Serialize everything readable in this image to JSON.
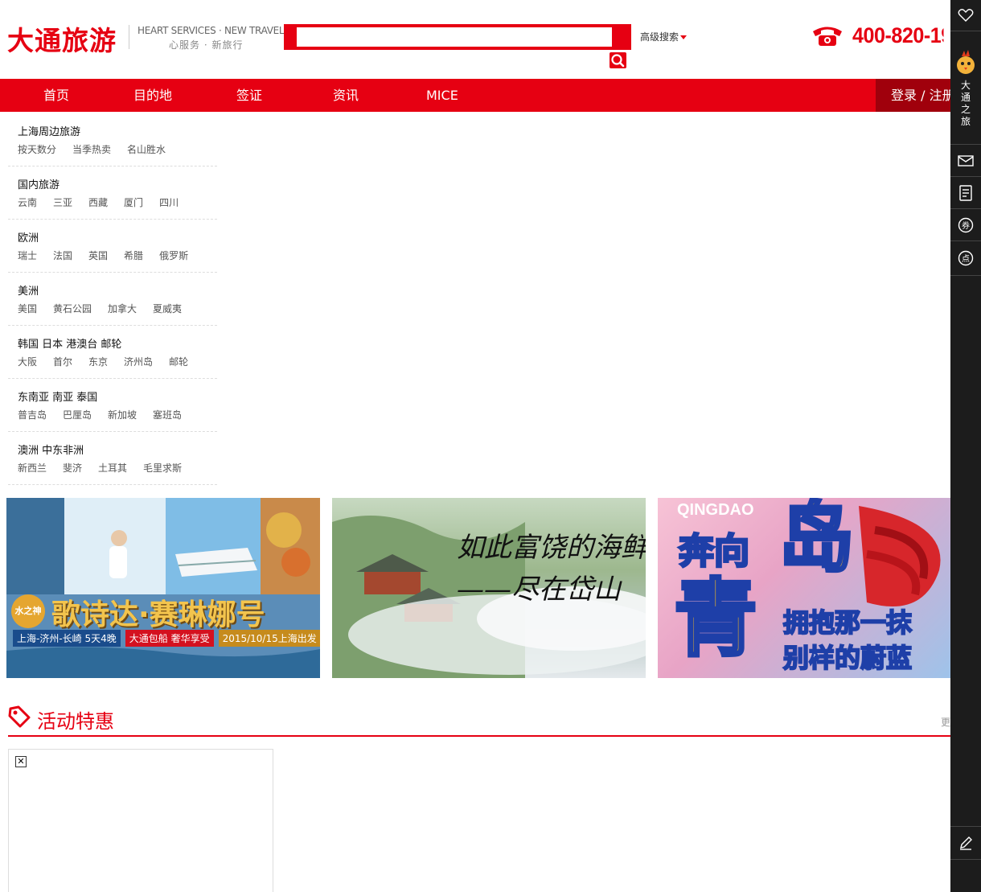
{
  "header": {
    "logo_text": "大通旅游",
    "slogan_en": "HEART SERVICES · NEW TRAVEL",
    "slogan_cn": "心服务 · 新旅行",
    "search_value": "",
    "advanced_search_label": "高级搜索",
    "phone_number": "400-820-19",
    "brand_color": "#e60012"
  },
  "nav": {
    "items": [
      {
        "label": "首页"
      },
      {
        "label": "目的地"
      },
      {
        "label": "签证"
      },
      {
        "label": "资讯"
      },
      {
        "label": "MICE"
      }
    ],
    "login_label": "登录 / 注册"
  },
  "categories": [
    {
      "title": "上海周边旅游",
      "links": [
        "按天数分",
        "当季热卖",
        "名山胜水"
      ]
    },
    {
      "title": "国内旅游",
      "links": [
        "云南",
        "三亚",
        "西藏",
        "厦门",
        "四川"
      ]
    },
    {
      "title": "欧洲",
      "links": [
        "瑞士",
        "法国",
        "英国",
        "希腊",
        "俄罗斯"
      ]
    },
    {
      "title": "美洲",
      "links": [
        "美国",
        "黄石公园",
        "加拿大",
        "夏威夷"
      ]
    },
    {
      "title": "韩国 日本 港澳台 邮轮",
      "links": [
        "大阪",
        "首尔",
        "东京",
        "济州岛",
        "邮轮"
      ]
    },
    {
      "title": "东南亚 南亚 泰国",
      "links": [
        "普吉岛",
        "巴厘岛",
        "新加坡",
        "塞班岛"
      ]
    },
    {
      "title": "澳洲 中东非洲",
      "links": [
        "新西兰",
        "斐济",
        "土耳其",
        "毛里求斯"
      ]
    }
  ],
  "banners": [
    {
      "badge": "水之神",
      "title": "歌诗达·赛琳娜号",
      "tags": [
        "上海-济州-长崎 5天4晚",
        "大通包船 奢华享受",
        "2015/10/15上海出发"
      ]
    },
    {
      "line1": "如此富饶的海鲜",
      "line2": "——尽在岱山"
    },
    {
      "city": "QINGDAO",
      "text1": "奔向",
      "text2": "岛",
      "text3": "青",
      "text4": "拥抱那一抹",
      "text5": "别样的蔚蓝"
    }
  ],
  "activity": {
    "title": "活动特惠",
    "more": "更"
  },
  "sidebar": {
    "brand_text": "大通之旅"
  }
}
